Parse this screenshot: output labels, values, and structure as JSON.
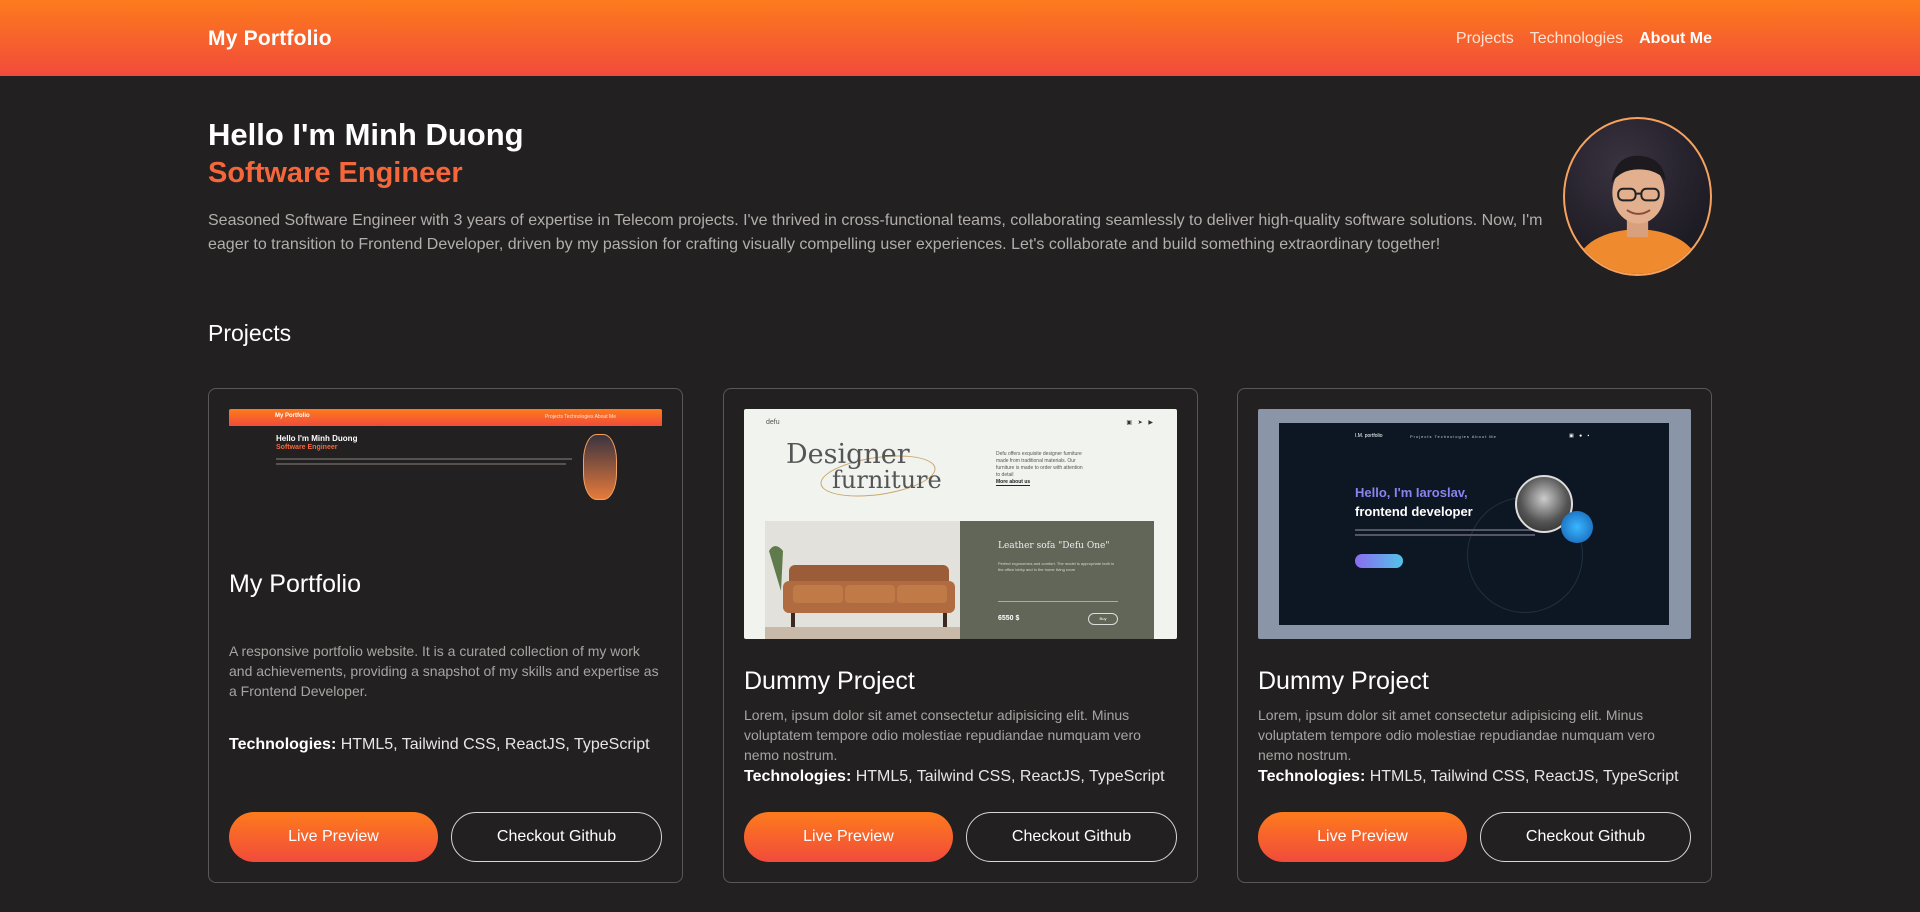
{
  "header": {
    "brand": "My Portfolio",
    "nav": [
      {
        "label": "Projects"
      },
      {
        "label": "Technologies"
      },
      {
        "label": "About Me"
      }
    ]
  },
  "hero": {
    "greeting": "Hello I'm Minh Duong",
    "role": "Software Engineer",
    "bio": "Seasoned Software Engineer with 3 years of expertise in Telecom projects. I've thrived in cross-functional teams, collaborating seamlessly to deliver high-quality software solutions. Now, I'm eager to transition to Frontend Developer, driven by my passion for crafting visually compelling user experiences. Let's collaborate and build something extraordinary together!"
  },
  "projects": {
    "title": "Projects",
    "tech_label": "Technologies:",
    "cards": [
      {
        "title": "My Portfolio",
        "description": "A responsive portfolio website. It is a curated collection of my work and achievements, providing a snapshot of my skills and expertise as a Frontend Developer.",
        "technologies": " HTML5, Tailwind CSS, ReactJS, TypeScript",
        "live_label": "Live Preview",
        "github_label": "Checkout Github",
        "thumb": {
          "brand": "My Portfolio",
          "nav": "Projects   Technologies   About Me",
          "greeting": "Hello I'm Minh Duong",
          "role": "Software Engineer"
        }
      },
      {
        "title": "Dummy Project",
        "description": "Lorem, ipsum dolor sit amet consectetur adipisicing elit. Minus voluptatem tempore odio molestiae repudiandae numquam vero nemo nostrum.",
        "technologies": " HTML5, Tailwind CSS, ReactJS, TypeScript",
        "live_label": "Live Preview",
        "github_label": "Checkout Github",
        "thumb": {
          "logo": "defu",
          "headline_1": "Designer",
          "headline_2": "furniture",
          "side_text": "Defu offers exquisite designer furniture made from traditional materials. Our furniture is made to order with attention to detail",
          "more": "More about us",
          "product": "Leather sofa \"Defu One\"",
          "product_text": "Perfect ergonomics and comfort. The model is appropriate both in the office lobby and in the home living room",
          "price": "6550 $",
          "buy": "Buy"
        }
      },
      {
        "title": "Dummy Project",
        "description": "Lorem, ipsum dolor sit amet consectetur adipisicing elit. Minus voluptatem tempore odio molestiae repudiandae numquam vero nemo nostrum.",
        "technologies": " HTML5, Tailwind CSS, ReactJS, TypeScript",
        "live_label": "Live Preview",
        "github_label": "Checkout Github",
        "thumb": {
          "brand": "I.M. portfolio",
          "nav": "Projects   Technologies   About Me",
          "greeting": "Hello, I'm Iaroslav,",
          "role": "frontend developer"
        }
      }
    ]
  },
  "colors": {
    "accent": "#f5673a",
    "header_top": "#fd7b1c",
    "header_bottom": "#f14b3b",
    "background": "#222021"
  }
}
